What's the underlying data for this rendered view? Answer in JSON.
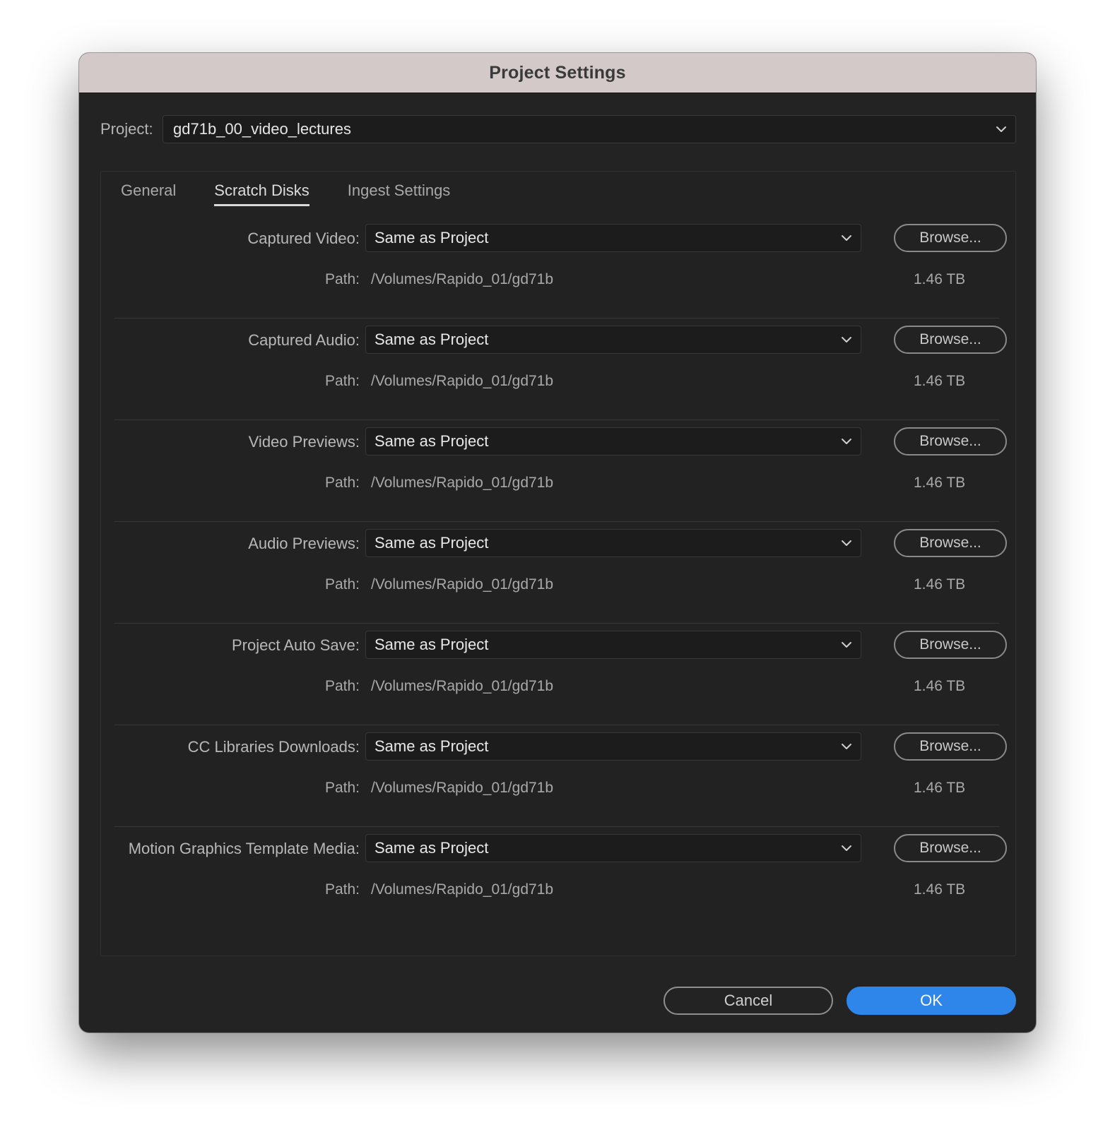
{
  "dialog": {
    "title": "Project Settings"
  },
  "project": {
    "label": "Project:",
    "value": "gd71b_00_video_lectures"
  },
  "tabs": [
    {
      "label": "General",
      "active": false
    },
    {
      "label": "Scratch Disks",
      "active": true
    },
    {
      "label": "Ingest Settings",
      "active": false
    }
  ],
  "scratch_disks": [
    {
      "label": "Captured Video:",
      "value": "Same as Project",
      "browse": "Browse...",
      "path_label": "Path:",
      "path": "/Volumes/Rapido_01/gd71b",
      "size": "1.46 TB"
    },
    {
      "label": "Captured Audio:",
      "value": "Same as Project",
      "browse": "Browse...",
      "path_label": "Path:",
      "path": "/Volumes/Rapido_01/gd71b",
      "size": "1.46 TB"
    },
    {
      "label": "Video Previews:",
      "value": "Same as Project",
      "browse": "Browse...",
      "path_label": "Path:",
      "path": "/Volumes/Rapido_01/gd71b",
      "size": "1.46 TB"
    },
    {
      "label": "Audio Previews:",
      "value": "Same as Project",
      "browse": "Browse...",
      "path_label": "Path:",
      "path": "/Volumes/Rapido_01/gd71b",
      "size": "1.46 TB"
    },
    {
      "label": "Project Auto Save:",
      "value": "Same as Project",
      "browse": "Browse...",
      "path_label": "Path:",
      "path": "/Volumes/Rapido_01/gd71b",
      "size": "1.46 TB"
    },
    {
      "label": "CC Libraries Downloads:",
      "value": "Same as Project",
      "browse": "Browse...",
      "path_label": "Path:",
      "path": "/Volumes/Rapido_01/gd71b",
      "size": "1.46 TB"
    },
    {
      "label": "Motion Graphics Template Media:",
      "value": "Same as Project",
      "browse": "Browse...",
      "path_label": "Path:",
      "path": "/Volumes/Rapido_01/gd71b",
      "size": "1.46 TB"
    }
  ],
  "footer": {
    "cancel": "Cancel",
    "ok": "OK"
  },
  "colors": {
    "accent": "#2f86ea",
    "window_bg": "#232323",
    "titlebar_bg": "#d3c9c9"
  },
  "icons": {
    "dropdown": "chevron-down-icon"
  }
}
